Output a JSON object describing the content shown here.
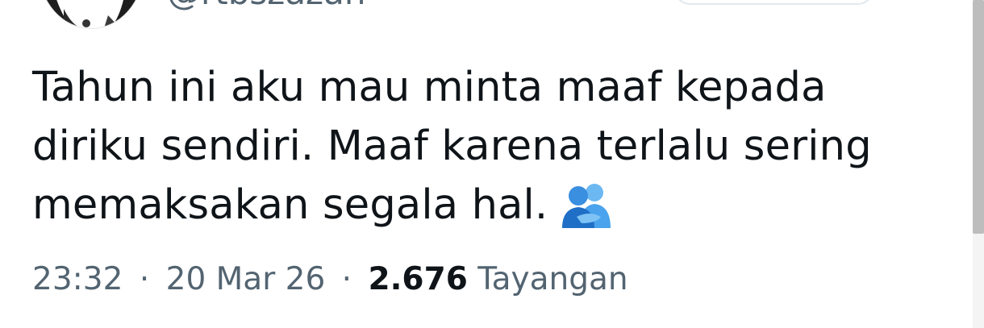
{
  "author": {
    "handle": "@rtbszazan",
    "avatar_icon": "profile-avatar"
  },
  "tweet": {
    "lines": [
      "Tahun ini aku mau minta maaf kepada",
      "diriku sendiri. Maaf karena terlalu sering",
      "memaksakan segala hal."
    ],
    "emoji": "people-hugging-icon"
  },
  "meta": {
    "time": "23:32",
    "separator": "·",
    "date": "20 Mar 26",
    "views_count": "2.676",
    "views_label": "Tayangan"
  },
  "colors": {
    "text": "#0f1419",
    "secondary": "#536471",
    "emoji_blue": "#2b8fe6"
  }
}
